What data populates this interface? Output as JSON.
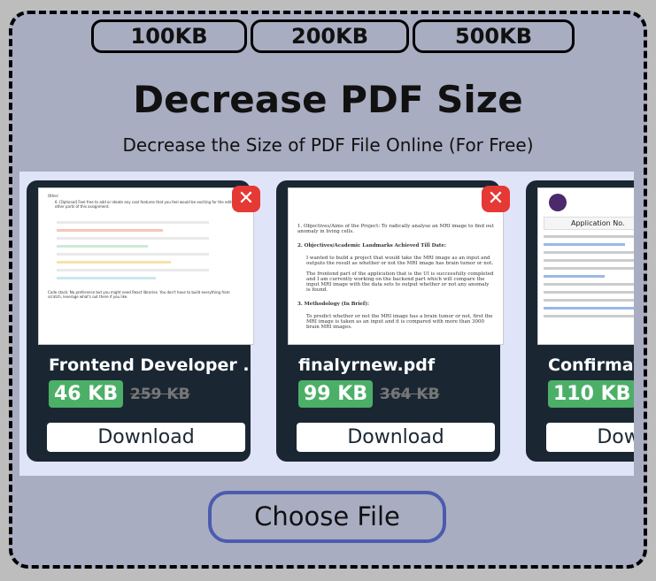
{
  "sizes": [
    "100KB",
    "200KB",
    "500KB"
  ],
  "title": "Decrease PDF Size",
  "subtitle": "Decrease the Size of PDF File Online (For Free)",
  "files": [
    {
      "name": "Frontend Developer ...",
      "compressed": "46 KB",
      "original": "259 KB",
      "download": "Download",
      "preview": [
        "Other:",
        "6. [Optional] Feel free to add or ideate any cool features that you feel would be exciting for the editor or other parts of this assignment.",
        "Code stack: No preference but you might need React libraries. You don't have to build everything from scratch, leverage what's out there if you like."
      ]
    },
    {
      "name": "finalyrnew.pdf",
      "compressed": "99 KB",
      "original": "364 KB",
      "download": "Download",
      "preview": [
        "1. Objectives/Aims of the Project: To radically analyse an MRI image to find out anomaly in living cells.",
        "2. Objectives/Academic Landmarks Achieved Till Date:",
        "I wanted to build a project that would take the MRI image as an input and outputs the result as whether or not the MRI image has brain tumor or not.",
        "The frontend part of the application that is the UI is successfully completed and I am currently working on the backend part which will compare the input MRI image with the data sets to output whether or not any anomaly is found.",
        "3. Methodology (In Brief):",
        "To predict whether or not the MRI image has a brain tumor or not, first the MRI image is taken as an input and it is compared with more than 3000 brain MRI images."
      ]
    },
    {
      "name": "Confirmation",
      "compressed": "110 KB",
      "original": "",
      "download": "Download",
      "preview": [
        "Application No."
      ]
    }
  ],
  "close_icon": "✕",
  "choose_file": "Choose File",
  "colors": {
    "badge": "#4caf68",
    "card": "#1a2733",
    "close": "#e53935",
    "choose_border": "#4a5bb0"
  }
}
